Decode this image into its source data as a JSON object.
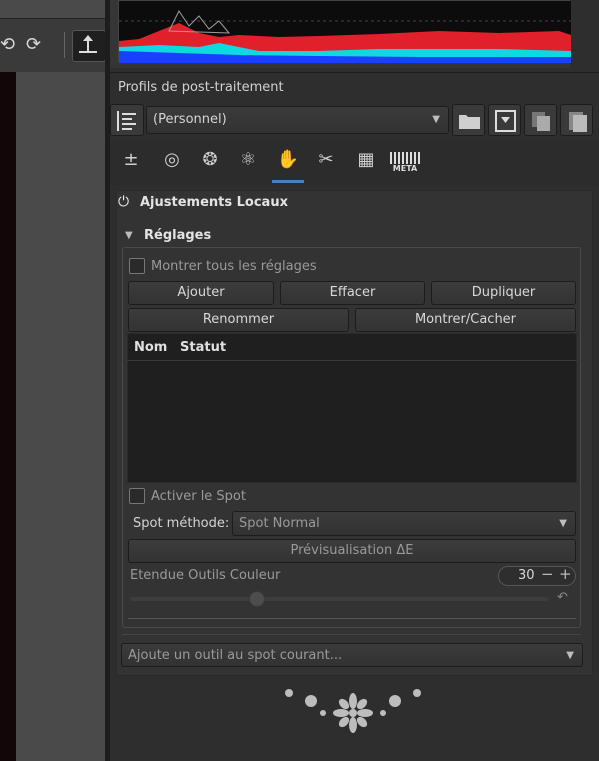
{
  "profiles": {
    "title": "Profils de post-traitement",
    "selected": "(Personnel)"
  },
  "tool_tabs": [
    "exposure-icon",
    "detail-icon",
    "color-icon",
    "advanced-icon",
    "local-adjustments-icon",
    "transform-icon",
    "raw-icon",
    "metadata-icon"
  ],
  "metadata_tab_label": "META",
  "locallab": {
    "section_title": "Ajustements Locaux",
    "settings_title": "Réglages",
    "show_all_label": "Montrer tous les réglages",
    "buttons": {
      "add": "Ajouter",
      "delete": "Effacer",
      "duplicate": "Dupliquer",
      "rename": "Renommer",
      "show_hide": "Montrer/Cacher"
    },
    "table_headers": {
      "name": "Nom",
      "status": "Statut"
    },
    "activate_spot_label": "Activer le Spot",
    "spot_method_label": "Spot méthode:",
    "spot_method_value": "Spot Normal",
    "preview_button": "Prévisualisation ΔE",
    "color_tool_range_label": "Etendue Outils Couleur",
    "color_tool_range_value": "30",
    "color_tool_range_fraction": 0.3,
    "add_tool_placeholder": "Ajoute un outil au spot courant..."
  },
  "colors": {
    "accent": "#4a7fc4",
    "panel_bg": "#2e2e2e"
  }
}
